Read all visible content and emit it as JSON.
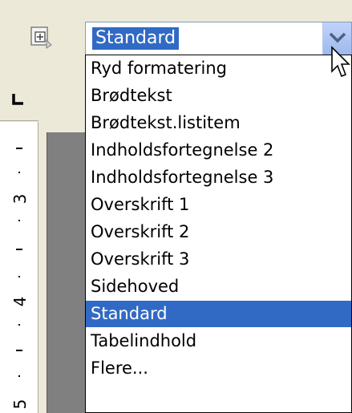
{
  "style_box": {
    "value": "Standard",
    "selected_item": "Standard"
  },
  "dropdown": {
    "items": [
      {
        "label": "Ryd formatering"
      },
      {
        "label": "Brødtekst"
      },
      {
        "label": "Brødtekst.listitem"
      },
      {
        "label": "Indholdsfortegnelse 2"
      },
      {
        "label": "Indholdsfortegnelse 3"
      },
      {
        "label": "Overskrift 1"
      },
      {
        "label": "Overskrift 2"
      },
      {
        "label": "Overskrift 3"
      },
      {
        "label": "Sidehoved"
      },
      {
        "label": "Standard"
      },
      {
        "label": "Tabelindhold"
      },
      {
        "label": "Flere..."
      }
    ]
  },
  "ruler": {
    "numbers": [
      "3",
      "4",
      "5"
    ]
  },
  "colors": {
    "selection": "#316ac5",
    "toolbar": "#ece9d8",
    "arrow_button": "#9db9eb"
  },
  "icons": {
    "styles_button": "styles-formatting-icon",
    "combo_arrow": "chevron-down-icon",
    "tab_stop": "left-tab-icon",
    "pointer": "mouse-pointer-icon"
  }
}
